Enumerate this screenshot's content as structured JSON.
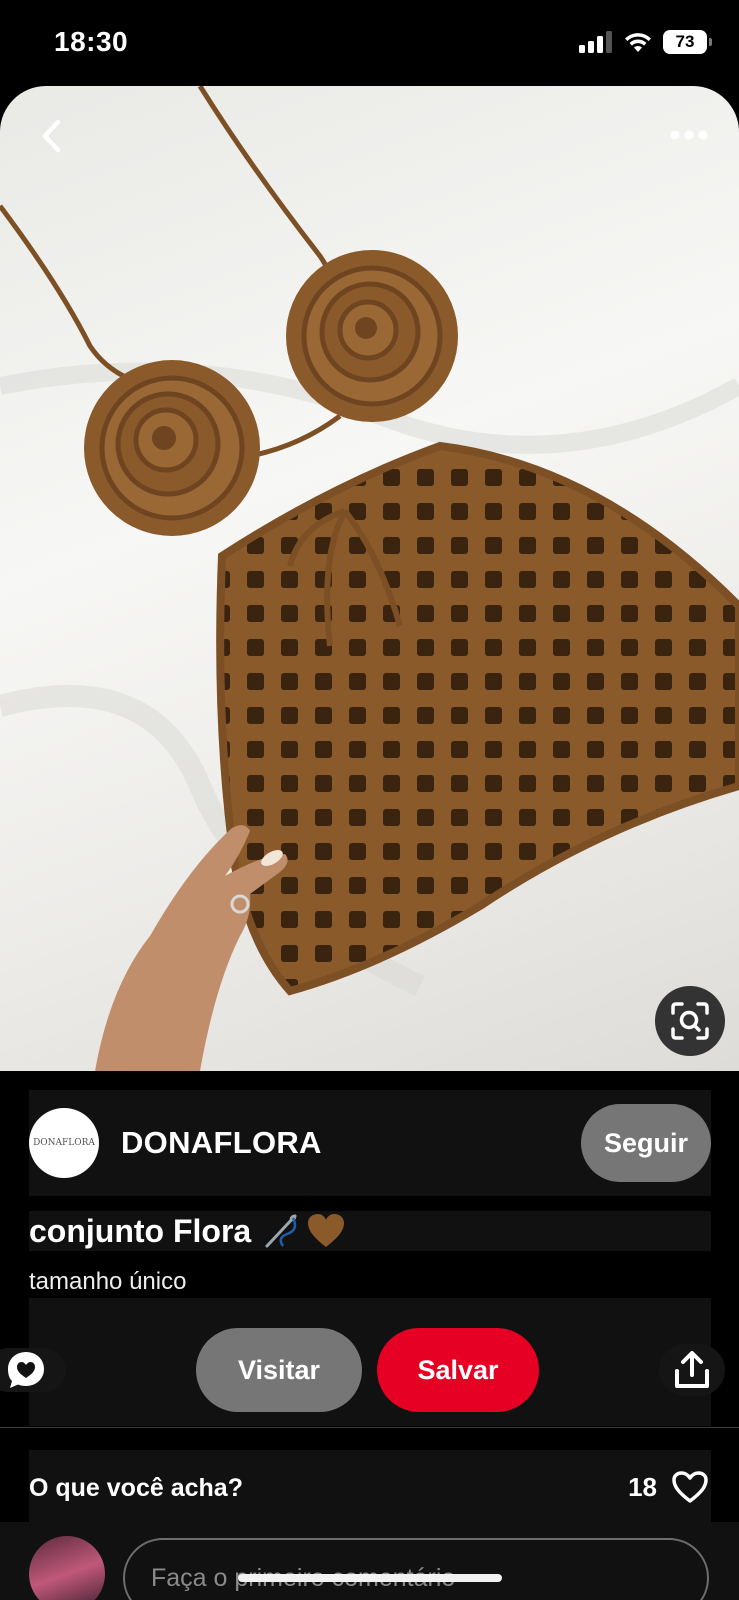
{
  "status_bar": {
    "time": "18:30",
    "battery": "73"
  },
  "creator": {
    "name": "DONAFLORA",
    "avatar_text": "DONAFLORA",
    "follow_label": "Seguir"
  },
  "pin": {
    "title": "conjunto Flora",
    "title_emojis": [
      "needle-thread-icon",
      "brown-heart-icon"
    ],
    "description": "tamanho único"
  },
  "actions": {
    "visit_label": "Visitar",
    "save_label": "Salvar"
  },
  "comments": {
    "title": "O que você acha?",
    "like_count": "18",
    "input_placeholder": "Faça o primeiro comentário"
  },
  "colors": {
    "save": "#e60023",
    "secondary_button": "#767676",
    "background": "#000000",
    "yarn": "#8a5a2b"
  }
}
